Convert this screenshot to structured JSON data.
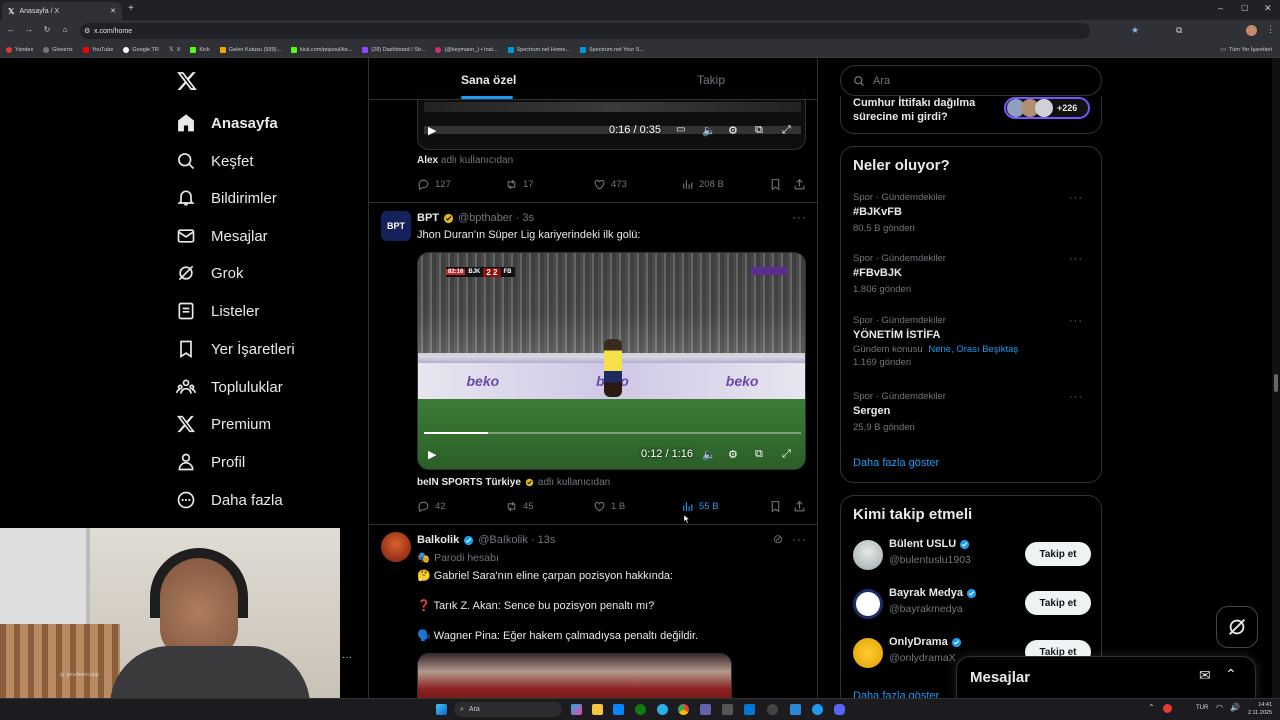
{
  "browser": {
    "tab_title": "Anasayfa / X",
    "url": "x.com/home",
    "bookmarks": [
      "Yandex",
      "Glovertz",
      "YouTube",
      "Google TR",
      "X",
      "Kick",
      "Gelen Kutusu (939)...",
      "kick.com/pojsoul/ke...",
      "(28) Dashboard / Str...",
      "(@keymann_) • Inst...",
      "Spectrum.net Home...",
      "Spectrum.net Your S..."
    ],
    "bookmarks_right": "Tüm Yer İşaretleri"
  },
  "nav": {
    "items": [
      "Anasayfa",
      "Keşfet",
      "Bildirimler",
      "Mesajlar",
      "Grok",
      "Listeler",
      "Yer İşaretleri",
      "Topluluklar",
      "Premium",
      "Profil",
      "Daha fazla"
    ]
  },
  "feed": {
    "tabs": [
      "Sana özel",
      "Takip"
    ],
    "tweet0": {
      "video_time": "0:16 / 0:35",
      "source_name": "Alex",
      "source_suffix": "adlı kullanıcıdan",
      "replies": "127",
      "reposts": "17",
      "likes": "473",
      "views": "208 B"
    },
    "tweet1": {
      "name": "BPT",
      "handle": "@bpthaber · 3s",
      "text": "Jhon Duran'ın Süper Lig kariyerindeki ilk golü:",
      "score_minute": "82:16",
      "score_home": "BJK",
      "score": "2 2",
      "score_away": "FB",
      "video_time": "0:12 / 1:16",
      "progress": 0.17,
      "source_name": "beIN SPORTS Türkiye",
      "source_suffix": "adlı kullanıcıdan",
      "replies": "42",
      "reposts": "45",
      "likes": "1 B",
      "views": "55 B"
    },
    "tweet2": {
      "name": "Balkolik",
      "handle": "@BaIkolik · 13s",
      "parody": "Parodi hesabı",
      "line1": "🤔 Gabriel Sara'nın eline çarpan pozisyon hakkında:",
      "line2": "❓ Tarık Z. Akan: Sence bu pozisyon penaltı mı?",
      "line3": "🗣️ Wagner Pina: Eğer hakem çalmadıysa penaltı değildir."
    }
  },
  "right": {
    "search_placeholder": "Ara",
    "top_card": {
      "text": "Cumhur İttifakı dağılma sürecine mi girdi?",
      "count": "+226"
    },
    "trends_title": "Neler oluyor?",
    "trends": [
      {
        "category": "Spor · Gündemdekiler",
        "name": "#BJKvFB",
        "count": "80,5 B gönderi"
      },
      {
        "category": "Spor · Gündemdekiler",
        "name": "#FBvBJK",
        "count": "1.806 gönderi"
      },
      {
        "category": "Spor · Gündemdekiler",
        "name": "YÖNETİM İSTİFA",
        "context": "Gündem konusu",
        "context_links": "Nene, Orası Beşiktaş",
        "count": "1.169 gönderi"
      },
      {
        "category": "Spor · Gündemdekiler",
        "name": "Sergen",
        "count": "25,9 B gönderi"
      }
    ],
    "show_more": "Daha fazla göster",
    "who_to_follow_title": "Kimi takip etmeli",
    "follow": [
      {
        "name": "Bülent USLU",
        "handle": "@bulentuslu1903",
        "button": "Takip et"
      },
      {
        "name": "Bayrak Medya",
        "handle": "@bayrakmedya",
        "button": "Takip et"
      },
      {
        "name": "OnlyDrama",
        "handle": "@onlydramaX",
        "button": "Takip et"
      }
    ],
    "more_partial": "Daha fazla göster",
    "messages_label": "Mesajlar"
  },
  "webcam": {
    "watermark": "ig: proofsoon.app"
  },
  "taskbar": {
    "search": "Ara",
    "lang": "TUR",
    "time": "14:41",
    "date": "2.11.2025"
  },
  "colors": {
    "accent": "#1d9bf0",
    "background": "#000000",
    "border": "#2f3336",
    "verified": "#1d9bf0",
    "gold": "#e2b719"
  }
}
